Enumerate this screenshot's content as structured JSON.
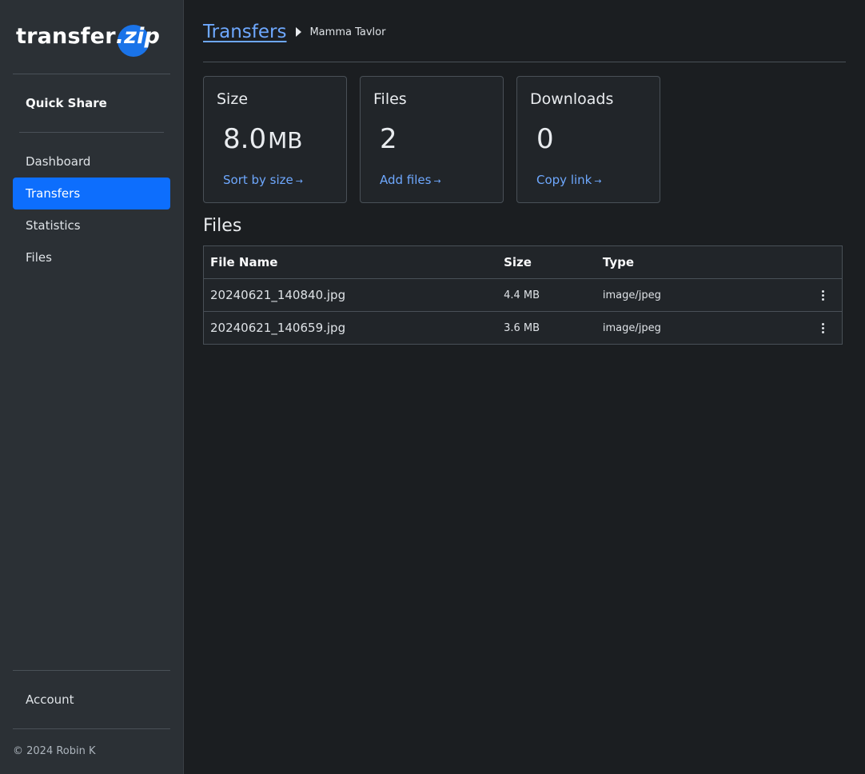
{
  "brand": {
    "name_part1": "transfer",
    "name_part2": ".zip"
  },
  "sidebar": {
    "quick_share": "Quick Share",
    "items": [
      {
        "label": "Dashboard"
      },
      {
        "label": "Transfers"
      },
      {
        "label": "Statistics"
      },
      {
        "label": "Files"
      }
    ],
    "active_item": "Transfers",
    "account": "Account",
    "copyright": "© 2024 Robin K"
  },
  "breadcrumb": {
    "root": "Transfers",
    "current": "Mamma Tavlor"
  },
  "stats": {
    "size": {
      "title": "Size",
      "value": "8.0",
      "unit": "MB",
      "link": "Sort by size",
      "link_arrow": "→"
    },
    "files": {
      "title": "Files",
      "value": "2",
      "link": "Add files",
      "link_arrow": "→"
    },
    "downloads": {
      "title": "Downloads",
      "value": "0",
      "link": "Copy link",
      "link_arrow": "→"
    }
  },
  "files_section": {
    "heading": "Files",
    "columns": [
      "File Name",
      "Size",
      "Type"
    ],
    "rows": [
      {
        "name": "20240621_140840.jpg",
        "size": "4.4 MB",
        "type": "image/jpeg"
      },
      {
        "name": "20240621_140659.jpg",
        "size": "3.6 MB",
        "type": "image/jpeg"
      }
    ]
  },
  "colors": {
    "accent": "#0d6efd",
    "link": "#6ea8fe",
    "background": "#1b1e21",
    "sidebar": "#2b3035"
  }
}
